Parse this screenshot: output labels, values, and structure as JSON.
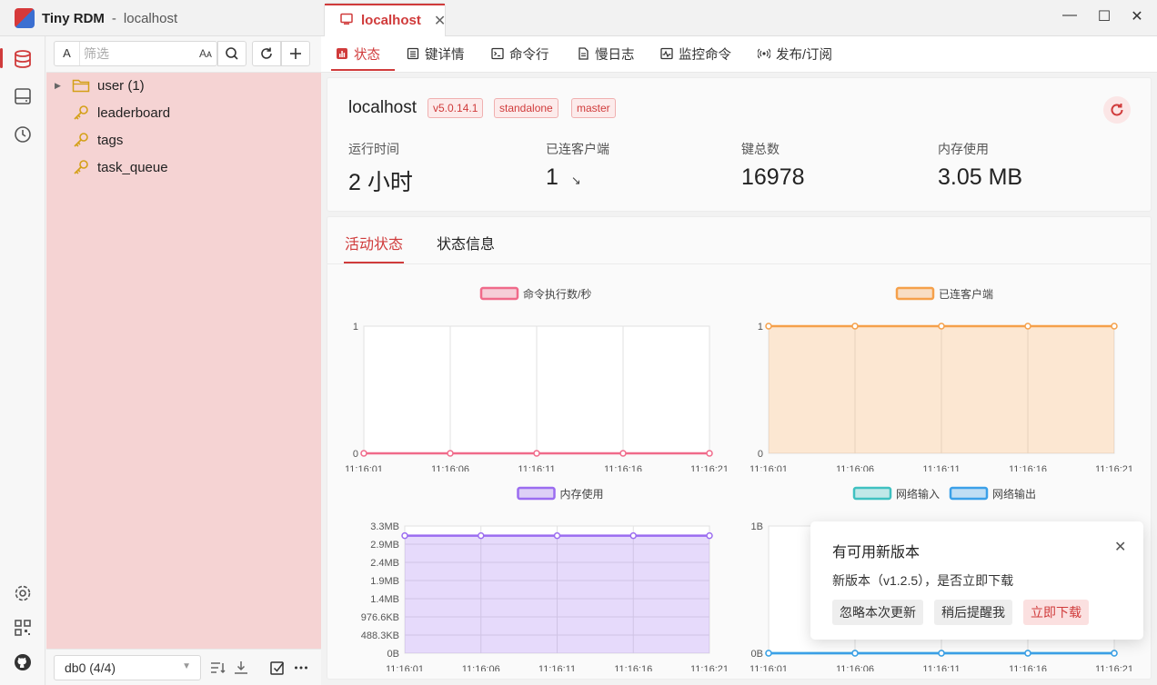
{
  "app": {
    "name": "Tiny RDM",
    "separator": "-",
    "connection": "localhost"
  },
  "tab": {
    "label": "localhost",
    "close": "✕"
  },
  "window_controls": {
    "minimize": "—",
    "maximize": "☐",
    "close": "✕"
  },
  "sidebar": {
    "filter_prefix": "A",
    "filter_placeholder": "筛选",
    "filter_case": "Aᴀ",
    "keys": [
      {
        "label": "user (1)",
        "type": "folder"
      },
      {
        "label": "leaderboard",
        "type": "key"
      },
      {
        "label": "tags",
        "type": "key"
      },
      {
        "label": "task_queue",
        "type": "key"
      }
    ],
    "db_select": "db0 (4/4)"
  },
  "subtabs": [
    {
      "label": "状态",
      "icon": "bar-chart-icon"
    },
    {
      "label": "键详情",
      "icon": "detail-icon"
    },
    {
      "label": "命令行",
      "icon": "terminal-icon"
    },
    {
      "label": "慢日志",
      "icon": "log-icon"
    },
    {
      "label": "监控命令",
      "icon": "monitor-icon"
    },
    {
      "label": "发布/订阅",
      "icon": "broadcast-icon"
    }
  ],
  "server": {
    "host": "localhost",
    "badges": [
      "v5.0.14.1",
      "standalone",
      "master"
    ],
    "stats": [
      {
        "label": "运行时间",
        "value": "2 小时"
      },
      {
        "label": "已连客户端",
        "value": "1",
        "trend": "↘"
      },
      {
        "label": "键总数",
        "value": "16978"
      },
      {
        "label": "内存使用",
        "value": "3.05 MB"
      }
    ]
  },
  "panel_tabs": [
    "活动状态",
    "状态信息"
  ],
  "colors": {
    "accent": "#d03b3b",
    "sidebar_bg": "#f5d3d3"
  },
  "chart_data": [
    {
      "type": "line",
      "series": [
        {
          "name": "命令执行数/秒",
          "values": [
            0,
            0,
            0,
            0,
            0
          ]
        }
      ],
      "x": [
        "11:16:01",
        "11:16:06",
        "11:16:11",
        "11:16:16",
        "11:16:21"
      ],
      "yticks": [
        "0",
        "1"
      ],
      "ylim": [
        0,
        1
      ],
      "color": "#f06a8a"
    },
    {
      "type": "area",
      "series": [
        {
          "name": "已连客户端",
          "values": [
            1,
            1,
            1,
            1,
            1
          ]
        }
      ],
      "x": [
        "11:16:01",
        "11:16:06",
        "11:16:11",
        "11:16:16",
        "11:16:21"
      ],
      "yticks": [
        "0",
        "1"
      ],
      "ylim": [
        0,
        1
      ],
      "color": "#f5a04a"
    },
    {
      "type": "area",
      "series": [
        {
          "name": "内存使用",
          "values": [
            3.05,
            3.05,
            3.05,
            3.05,
            3.05
          ]
        }
      ],
      "x": [
        "11:16:01",
        "11:16:06",
        "11:16:11",
        "11:16:16",
        "11:16:21"
      ],
      "yticks": [
        "0B",
        "488.3KB",
        "976.6KB",
        "1.4MB",
        "1.9MB",
        "2.4MB",
        "2.9MB",
        "3.3MB"
      ],
      "ylim": [
        0,
        3.3
      ],
      "color": "#9b6cf0"
    },
    {
      "type": "line",
      "series": [
        {
          "name": "网络输入",
          "values": [
            0,
            0,
            0,
            0,
            0
          ]
        },
        {
          "name": "网络输出",
          "values": [
            0,
            0,
            0,
            0,
            0
          ]
        }
      ],
      "x": [
        "11:16:01",
        "11:16:06",
        "11:16:11",
        "11:16:16",
        "11:16:21"
      ],
      "yticks": [
        "0B",
        "1B"
      ],
      "ylim": [
        0,
        1
      ],
      "colors": [
        "#3fc1c1",
        "#3ba0e8"
      ]
    }
  ],
  "notification": {
    "title": "有可用新版本",
    "body": "新版本（v1.2.5），是否立即下载",
    "buttons": [
      "忽略本次更新",
      "稍后提醒我",
      "立即下载"
    ],
    "close": "✕"
  }
}
